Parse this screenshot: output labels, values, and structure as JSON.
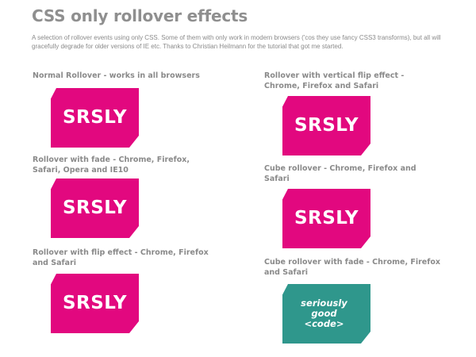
{
  "page": {
    "title": "CSS only rollover effects",
    "intro": "A selection of rollover events using only CSS. Some of them with only work in modern browsers ('cos they use fancy CSS3 transforms), but all will gracefully degrade for older versions of IE etc. Thanks to Christian Heilmann for the tutorial that got me started."
  },
  "colors": {
    "pink": "#e2087f",
    "teal": "#2f978c"
  },
  "examples": [
    {
      "heading": "Normal Rollover - works in all browsers",
      "tile_text": "SRSLY",
      "tile_color": "pink"
    },
    {
      "heading": "Rollover with fade - Chrome, Firefox, Safari, Opera and IE10",
      "tile_text": "SRSLY",
      "tile_color": "pink"
    },
    {
      "heading": "Rollover with flip effect - Chrome, Firefox and Safari",
      "tile_text": "SRSLY",
      "tile_color": "pink"
    },
    {
      "heading": "Rollover with vertical flip effect - Chrome, Firefox and Safari",
      "tile_text": "SRSLY",
      "tile_color": "pink"
    },
    {
      "heading": "Cube rollover - Chrome, Firefox and Safari",
      "tile_text": "SRSLY",
      "tile_color": "pink"
    },
    {
      "heading": "Cube rollover with fade - Chrome, Firefox and Safari",
      "tile_text": "seriously\ngood\n<code>",
      "tile_color": "teal"
    }
  ]
}
